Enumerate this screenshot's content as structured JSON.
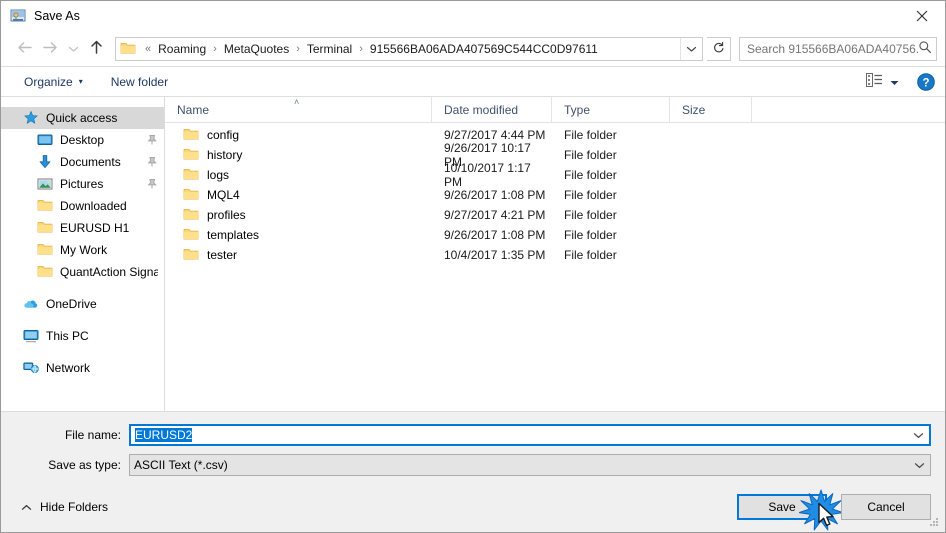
{
  "window": {
    "title": "Save As",
    "title_icon": "save-as-app-icon",
    "close_icon": "close-icon"
  },
  "navigation": {
    "back_icon": "arrow-left-icon",
    "forward_icon": "arrow-right-icon",
    "recent_icon": "chevron-down-icon",
    "up_icon": "arrow-up-icon",
    "refresh_icon": "refresh-icon",
    "folder_icon": "folder-icon",
    "dropdown_icon": "chevron-down-icon",
    "separator": "›",
    "prefix": "«",
    "breadcrumb": [
      "Roaming",
      "MetaQuotes",
      "Terminal",
      "915566BA06ADA407569C544CC0D97611"
    ]
  },
  "search": {
    "placeholder": "Search 915566BA06ADA40756...",
    "value": "",
    "icon": "search-icon"
  },
  "command_bar": {
    "organize_label": "Organize",
    "organize_caret": "▾",
    "new_folder_label": "New folder",
    "view_icon": "view-layout-icon",
    "view_caret": "▾",
    "help_icon": "help-icon",
    "help_label": "?"
  },
  "nav_pane": {
    "groups": [
      {
        "items": [
          {
            "label": "Quick access",
            "icon": "star-icon",
            "indent": 0,
            "selected": true,
            "pinned": false
          },
          {
            "label": "Desktop",
            "icon": "desktop-icon",
            "indent": 1,
            "selected": false,
            "pinned": true
          },
          {
            "label": "Documents",
            "icon": "documents-icon",
            "indent": 1,
            "selected": false,
            "pinned": true
          },
          {
            "label": "Pictures",
            "icon": "pictures-icon",
            "indent": 1,
            "selected": false,
            "pinned": true
          },
          {
            "label": "Downloaded",
            "icon": "folder-icon",
            "indent": 1,
            "selected": false,
            "pinned": false
          },
          {
            "label": "EURUSD H1",
            "icon": "folder-icon",
            "indent": 1,
            "selected": false,
            "pinned": false
          },
          {
            "label": "My Work",
            "icon": "folder-icon",
            "indent": 1,
            "selected": false,
            "pinned": false
          },
          {
            "label": "QuantAction Signal",
            "icon": "folder-icon",
            "indent": 1,
            "selected": false,
            "pinned": false
          }
        ]
      },
      {
        "items": [
          {
            "label": "OneDrive",
            "icon": "onedrive-icon",
            "indent": 0,
            "selected": false,
            "pinned": false
          }
        ]
      },
      {
        "items": [
          {
            "label": "This PC",
            "icon": "this-pc-icon",
            "indent": 0,
            "selected": false,
            "pinned": false
          }
        ]
      },
      {
        "items": [
          {
            "label": "Network",
            "icon": "network-icon",
            "indent": 0,
            "selected": false,
            "pinned": false
          }
        ]
      }
    ]
  },
  "file_list": {
    "columns": [
      "Name",
      "Date modified",
      "Type",
      "Size"
    ],
    "sort_column": "Name",
    "sort_caret": "˄",
    "rows": [
      {
        "name": "config",
        "date": "9/27/2017 4:44 PM",
        "type": "File folder",
        "size": "",
        "icon": "folder-icon"
      },
      {
        "name": "history",
        "date": "9/26/2017 10:17 PM",
        "type": "File folder",
        "size": "",
        "icon": "folder-icon"
      },
      {
        "name": "logs",
        "date": "10/10/2017 1:17 PM",
        "type": "File folder",
        "size": "",
        "icon": "folder-icon"
      },
      {
        "name": "MQL4",
        "date": "9/26/2017 1:08 PM",
        "type": "File folder",
        "size": "",
        "icon": "folder-icon"
      },
      {
        "name": "profiles",
        "date": "9/27/2017 4:21 PM",
        "type": "File folder",
        "size": "",
        "icon": "folder-icon"
      },
      {
        "name": "templates",
        "date": "9/26/2017 1:08 PM",
        "type": "File folder",
        "size": "",
        "icon": "folder-icon"
      },
      {
        "name": "tester",
        "date": "10/4/2017 1:35 PM",
        "type": "File folder",
        "size": "",
        "icon": "folder-icon"
      }
    ]
  },
  "form": {
    "file_name_label": "File name:",
    "file_name_value": "EURUSD2",
    "file_name_selected": true,
    "save_as_type_label": "Save as type:",
    "save_as_type_value": "ASCII Text (*.csv)",
    "dropdown_icon": "chevron-down-icon"
  },
  "actions": {
    "hide_folders_label": "Hide Folders",
    "hide_folders_icon": "chevron-up-icon",
    "save_label": "Save",
    "cancel_label": "Cancel",
    "resize_grip_icon": "resize-grip-icon",
    "click_burst_icon": "click-burst-icon",
    "cursor_icon": "mouse-pointer-icon"
  },
  "colors": {
    "accent": "#0078d7",
    "folder": "#fcd771",
    "selection_highlight": "#d8d8d8",
    "header_text": "#40516e",
    "command_text": "#1f3864",
    "dialog_bg": "#f0f0f0"
  }
}
